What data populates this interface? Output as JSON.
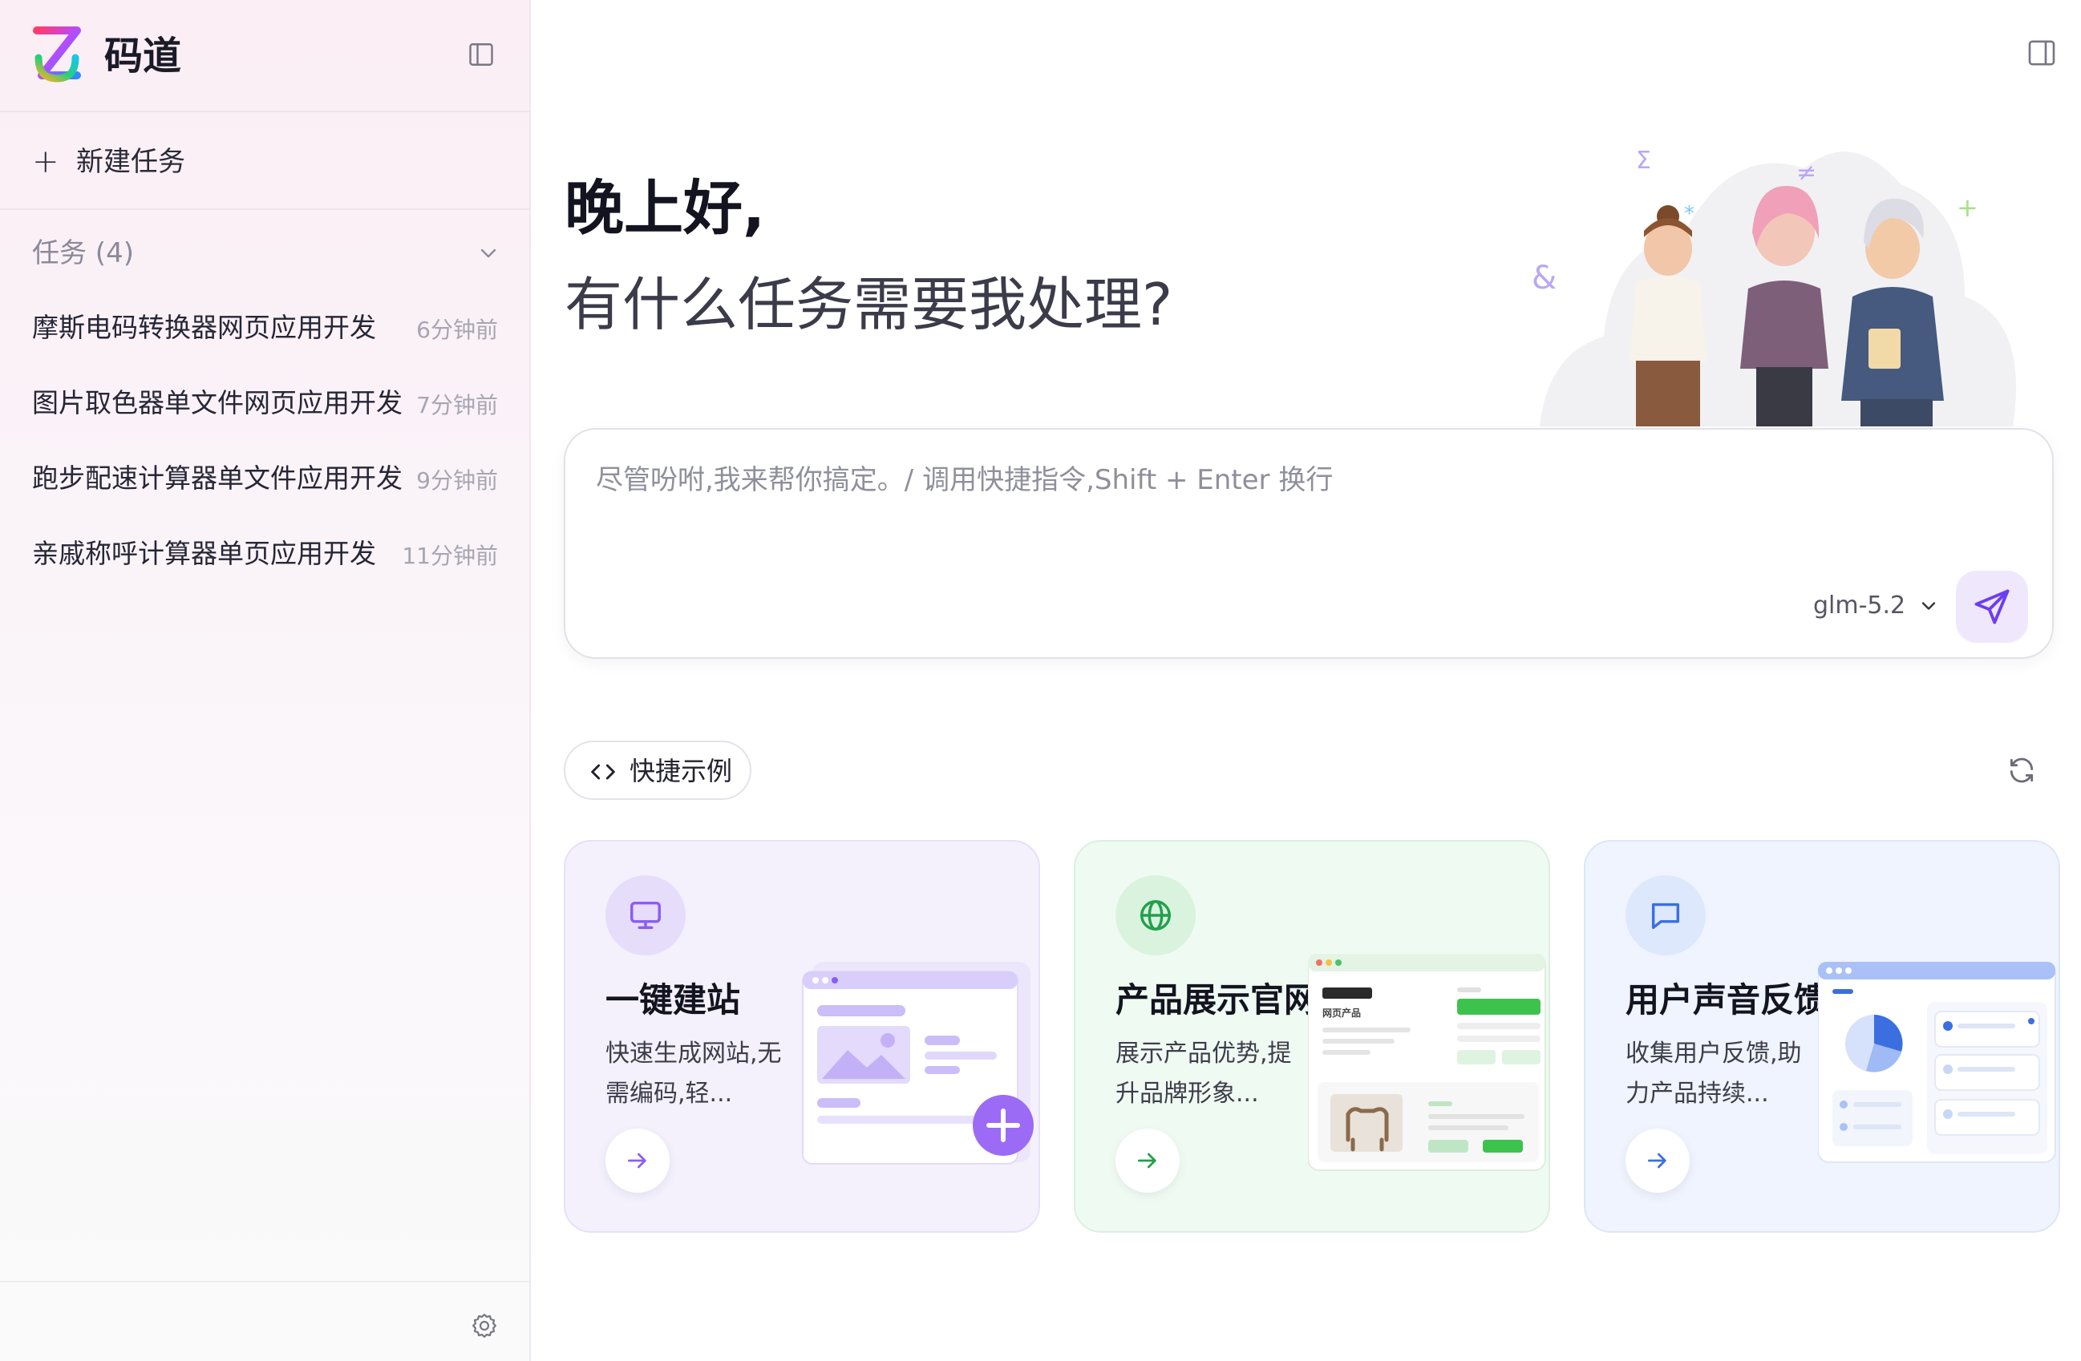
{
  "app": {
    "brand": "码道"
  },
  "sidebar": {
    "new_task_label": "新建任务",
    "tasks_header": "任务 (4)",
    "tasks": [
      {
        "name": "摩斯电码转换器网页应用开发",
        "time": "6分钟前"
      },
      {
        "name": "图片取色器单文件网页应用开发",
        "time": "7分钟前"
      },
      {
        "name": "跑步配速计算器单文件应用开发",
        "time": "9分钟前"
      },
      {
        "name": "亲戚称呼计算器单页应用开发",
        "time": "11分钟前"
      }
    ]
  },
  "main": {
    "greeting": "晚上好,",
    "subtitle": "有什么任务需要我处理?",
    "composer": {
      "placeholder": "尽管吩咐,我来帮你搞定。/ 调用快捷指令,Shift + Enter 换行",
      "model": "glm-5.2"
    },
    "examples_label": "快捷示例",
    "cards": [
      {
        "title": "一键建站",
        "desc": "快速生成网站,无需编码,轻...",
        "accent": "#8b5cf6"
      },
      {
        "title": "产品展示官网",
        "desc": "展示产品优势,提升品牌形象...",
        "accent": "#22a04b",
        "illus_text": "网页产品"
      },
      {
        "title": "用户声音反馈",
        "desc": "收集用户反馈,助力产品持续...",
        "accent": "#3b6fe0"
      }
    ]
  },
  "icons": {
    "sidebar_toggle": "panel-left-icon",
    "main_toggle": "panel-right-icon",
    "settings": "gear-icon",
    "send": "send-icon",
    "refresh": "refresh-icon",
    "code": "code-icon"
  }
}
